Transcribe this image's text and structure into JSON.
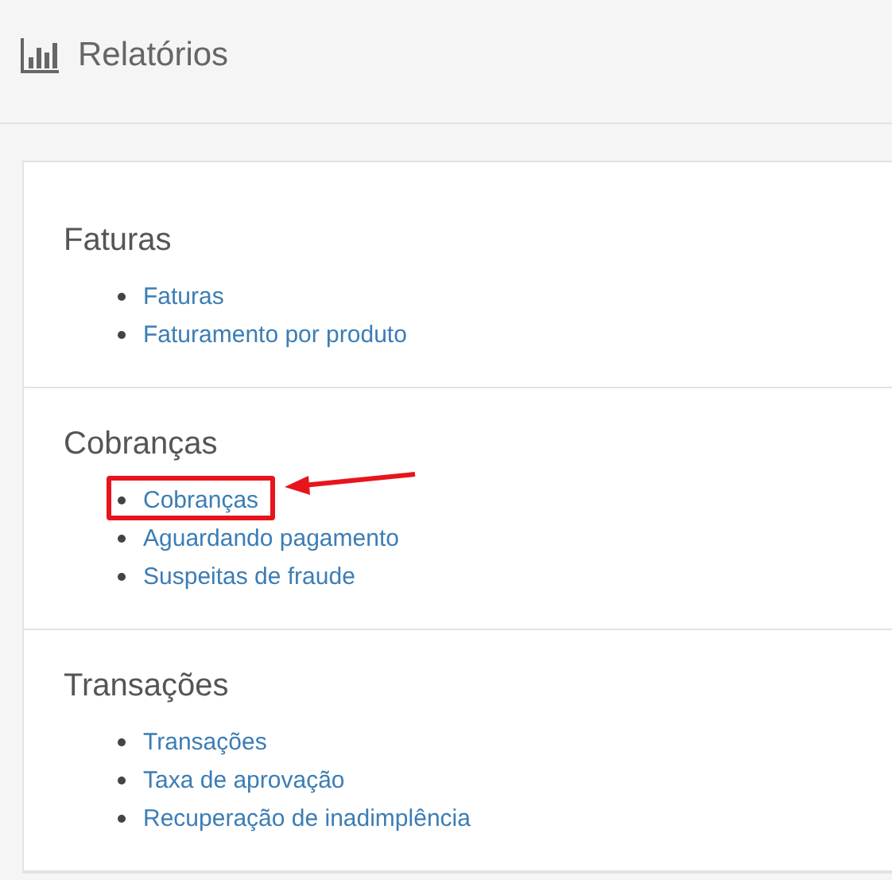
{
  "header": {
    "title": "Relatórios"
  },
  "sections": [
    {
      "title": "Faturas",
      "links": [
        {
          "label": "Faturas",
          "highlighted": false
        },
        {
          "label": "Faturamento por produto",
          "highlighted": false
        }
      ]
    },
    {
      "title": "Cobranças",
      "links": [
        {
          "label": "Cobranças",
          "highlighted": true
        },
        {
          "label": "Aguardando pagamento",
          "highlighted": false
        },
        {
          "label": "Suspeitas de fraude",
          "highlighted": false
        }
      ]
    },
    {
      "title": "Transações",
      "links": [
        {
          "label": "Transações",
          "highlighted": false
        },
        {
          "label": "Taxa de aprovação",
          "highlighted": false
        },
        {
          "label": "Recuperação de inadimplência",
          "highlighted": false
        }
      ]
    }
  ]
}
